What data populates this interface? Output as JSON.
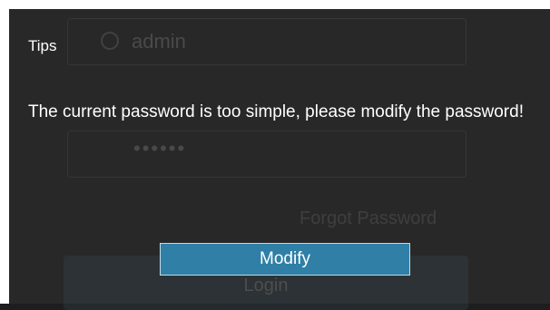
{
  "background_form": {
    "username": "admin",
    "password_mask": "••••••",
    "forgot_password": "Forgot Password",
    "login_label": "Login"
  },
  "dialog": {
    "title": "Tips",
    "message": "The current password is too simple, please modify the password!",
    "modify_label": "Modify"
  },
  "icons": {
    "user": "user-icon"
  },
  "colors": {
    "background": "#282828",
    "button": "#2f7fa6",
    "button_border": "#c8d8e2",
    "text": "#ffffff"
  }
}
